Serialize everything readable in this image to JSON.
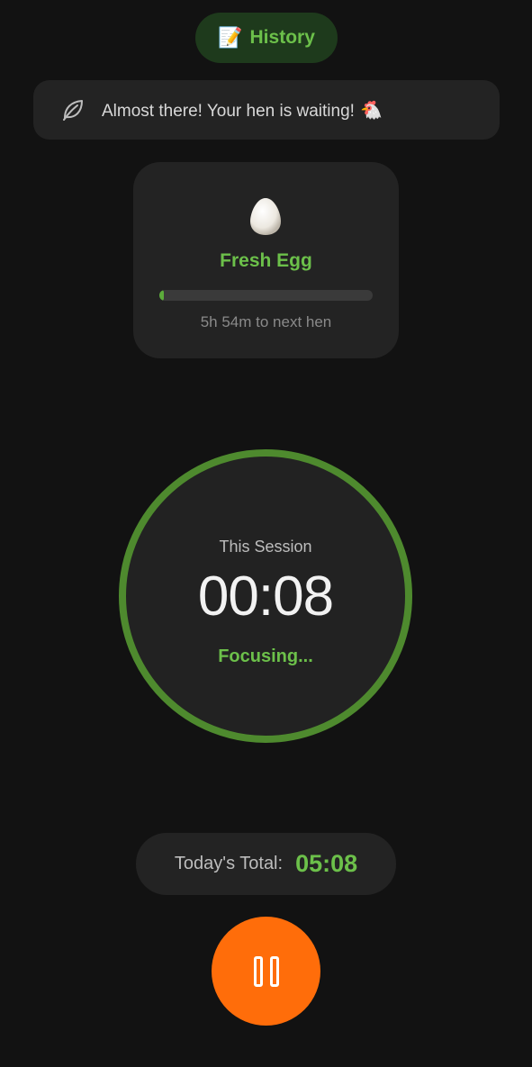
{
  "header": {
    "history_icon": "memo-icon",
    "history_emoji": "📝",
    "history_label": "History"
  },
  "message": {
    "icon": "leaf-icon",
    "text": "Almost there! Your hen is waiting!",
    "emoji": "🐔"
  },
  "egg_card": {
    "icon": "egg-icon",
    "stage_name": "Fresh Egg",
    "progress_fraction": 0.02,
    "next_hen_text": "5h 54m to next hen"
  },
  "timer": {
    "session_label": "This Session",
    "session_time": "00:08",
    "status": "Focusing..."
  },
  "totals": {
    "label": "Today's Total:",
    "value": "05:08"
  },
  "controls": {
    "pause_icon": "pause-icon"
  },
  "colors": {
    "background": "#121212",
    "card": "#232323",
    "accent_green": "#6cc04a",
    "ring_green": "#4e8a2e",
    "pause_orange": "#ff6d0a"
  }
}
